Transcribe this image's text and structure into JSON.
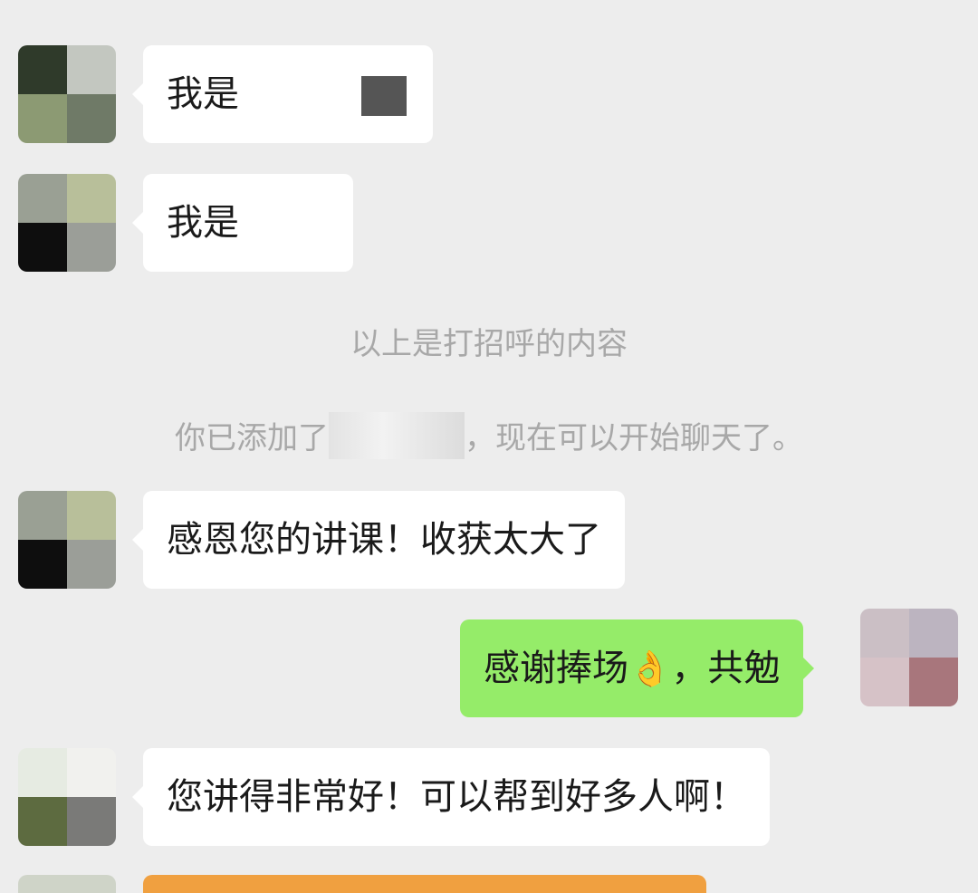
{
  "messages": [
    {
      "side": "left",
      "text": "我是"
    },
    {
      "side": "left",
      "text": "我是"
    },
    {
      "side": "left",
      "text": "感恩您的讲课！收获太大了"
    },
    {
      "side": "right",
      "text": "感谢捧场",
      "emoji": "👌",
      "text_after": "，共勉"
    },
    {
      "side": "left",
      "text": "您讲得非常好！可以帮到好多人啊！"
    }
  ],
  "system": {
    "greeting_notice": "以上是打招呼的内容",
    "added_prefix": "你已添加了",
    "added_suffix": "，现在可以开始聊天了。"
  },
  "colors": {
    "background": "#ededed",
    "bubble_left": "#ffffff",
    "bubble_right": "#95ec69",
    "system_text": "#a8a8a8"
  }
}
